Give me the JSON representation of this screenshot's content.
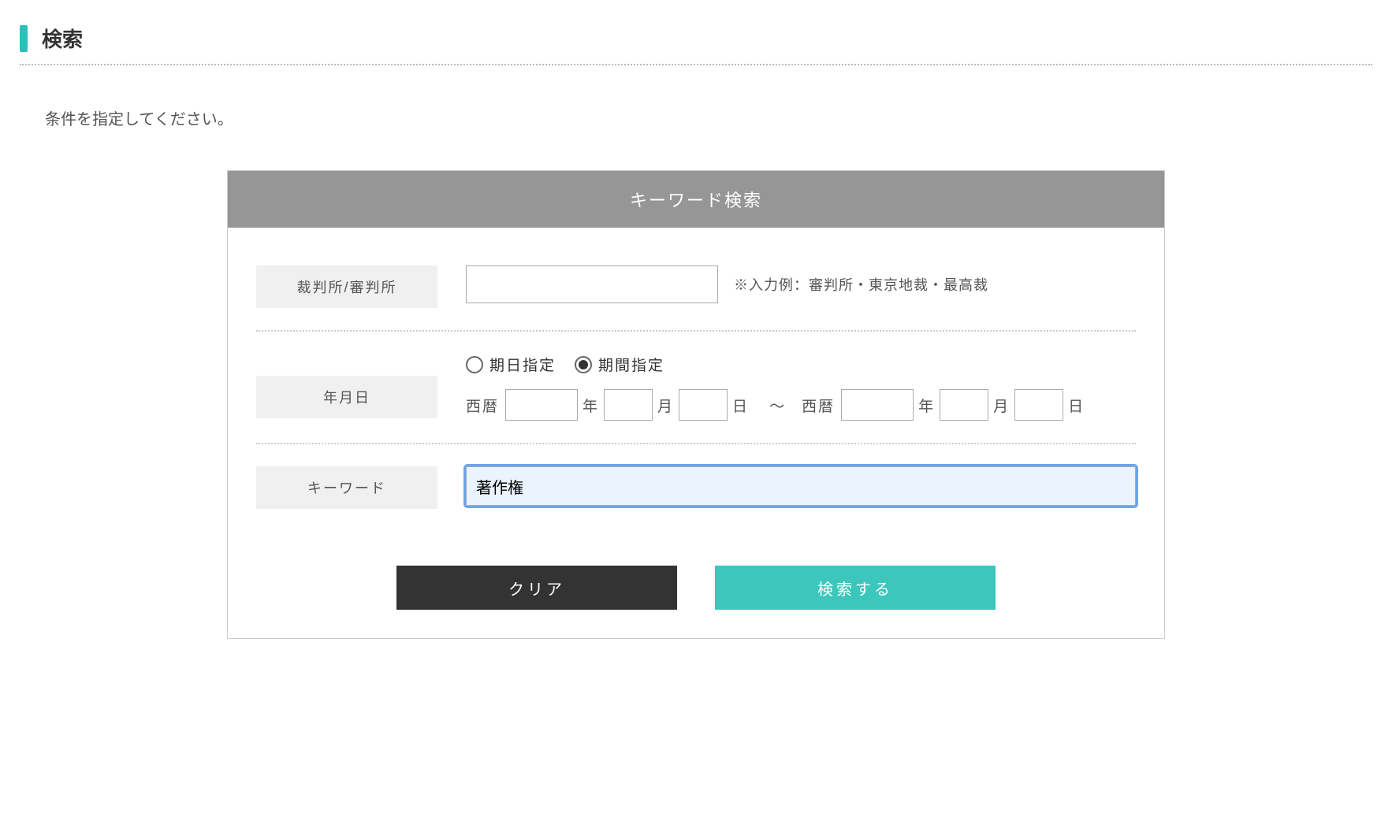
{
  "page": {
    "title": "検索",
    "instruction": "条件を指定してください。"
  },
  "panel": {
    "header": "キーワード検索"
  },
  "court": {
    "label": "裁判所/審判所",
    "value": "",
    "hint": "※入力例：審判所・東京地裁・最高裁"
  },
  "date": {
    "label": "年月日",
    "radio_date_label": "期日指定",
    "radio_range_label": "期間指定",
    "selected": "range",
    "era": "西暦",
    "unit_year": "年",
    "unit_month": "月",
    "unit_day": "日",
    "tilde": "〜",
    "from_year": "",
    "from_month": "",
    "from_day": "",
    "to_year": "",
    "to_month": "",
    "to_day": ""
  },
  "keyword": {
    "label": "キーワード",
    "value": "著作権"
  },
  "buttons": {
    "clear": "クリア",
    "search": "検索する"
  }
}
